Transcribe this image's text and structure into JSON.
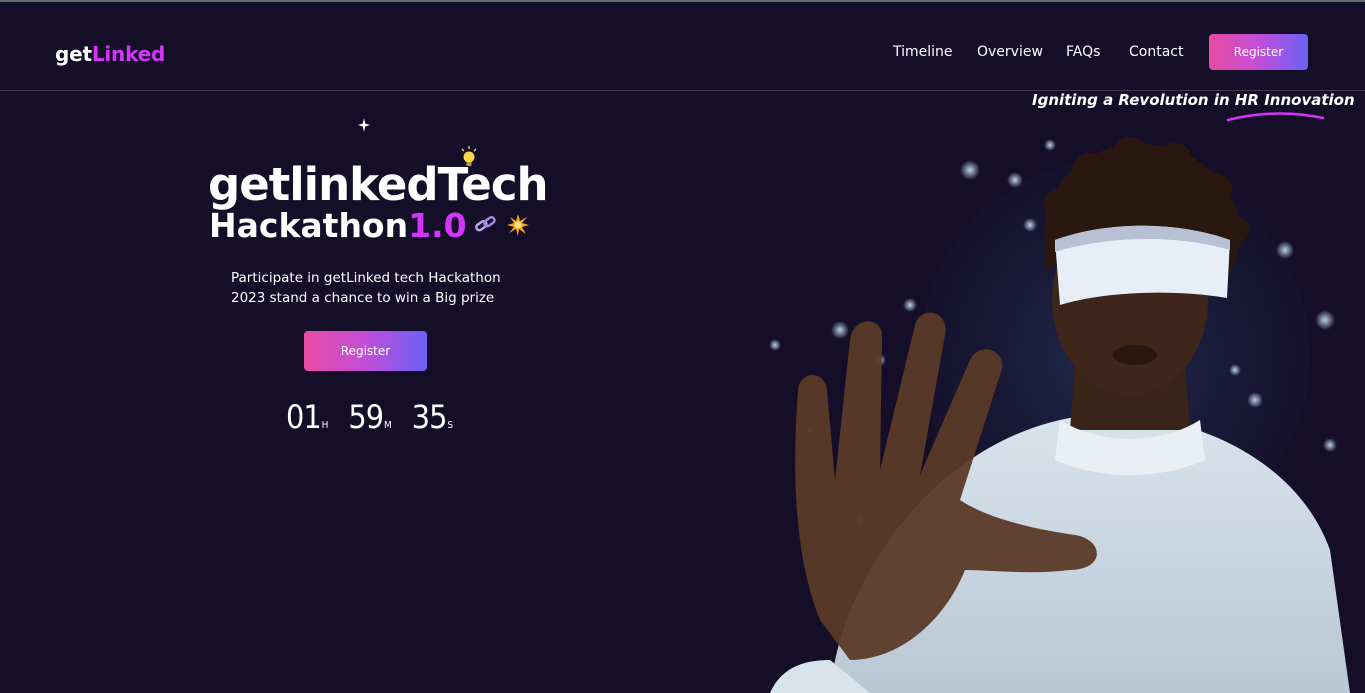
{
  "header": {
    "logo_prefix": "get",
    "logo_accent": "Linked",
    "nav": [
      "Timeline",
      "Overview",
      "FAQs",
      "Contact"
    ],
    "register_label": "Register"
  },
  "hero": {
    "tagline": "Igniting a Revolution in HR Innovation",
    "title_line1": "getlinkedTech",
    "title_line2": "Hackathon",
    "version": "1.0",
    "description_line1": "Participate in getLinked tech Hackathon",
    "description_line2": "2023 stand a chance to win a Big prize",
    "register_label": "Register",
    "timer": {
      "hours": "01",
      "hours_unit": "H",
      "minutes": "59",
      "minutes_unit": "M",
      "seconds": "35",
      "seconds_unit": "S"
    }
  },
  "colors": {
    "background": "#150e28",
    "accent": "#d434fe",
    "button_gradient_start": "#e94ba4",
    "button_gradient_end": "#6a61f5"
  },
  "icons": [
    "sparkle-icon",
    "lightbulb-icon",
    "chain-link-icon",
    "collision-icon"
  ]
}
